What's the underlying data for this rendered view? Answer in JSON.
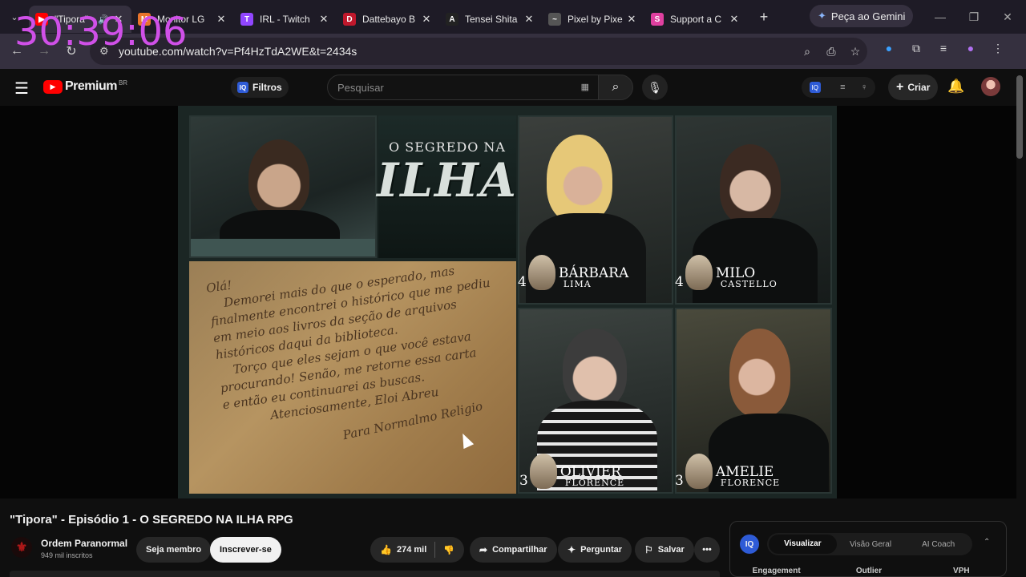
{
  "browser": {
    "tabs": [
      {
        "title": "\"Tipora\"",
        "color": "#ff0000",
        "glyph": "▶",
        "active": true
      },
      {
        "title": "Monitor LG",
        "color": "#e8742c",
        "glyph": "M",
        "active": false
      },
      {
        "title": "IRL - Twitch",
        "color": "#9146ff",
        "glyph": "T",
        "active": false
      },
      {
        "title": "Dattebayo B",
        "color": "#c0182c",
        "glyph": "D",
        "active": false
      },
      {
        "title": "Tensei Shita",
        "color": "#222222",
        "glyph": "A",
        "active": false
      },
      {
        "title": "Pixel by Pixe",
        "color": "#555555",
        "glyph": "~",
        "active": false
      },
      {
        "title": "Support a C",
        "color": "#e040a0",
        "glyph": "S",
        "active": false
      }
    ],
    "gemini_label": "Peça ao Gemini",
    "url": "youtube.com/watch?v=Pf4HzTdA2WE&t=2434s"
  },
  "overlay_timer": "30:39:06",
  "youtube": {
    "brand": "Premium",
    "region": "BR",
    "filtros_label": "Filtros",
    "search_placeholder": "Pesquisar",
    "create_label": "Criar"
  },
  "video": {
    "show_title_top": "O SEGREDO NA",
    "show_title_big": "ILHA",
    "letter_lines": "Olá!\n    Demorei mais do que o esperado, mas\nfinalmente encontrei o histórico que me pediu\nem meio aos livros da seção de arquivos\nhistóricos daqui da biblioteca.\n    Torço que eles sejam o que você estava\nprocurando! Senão, me retorne essa carta\ne então eu continuarei as buscas.\n            Atenciosamente, Eloi Abreu",
    "stamp_text": "Para Normalmo  Religio",
    "players": [
      {
        "first": "BÁRBARA",
        "last": "LIMA",
        "num": "4"
      },
      {
        "first": "MILO",
        "last": "CASTELLO",
        "num": "4"
      },
      {
        "first": "OLIVIER",
        "last": "FLORENCE",
        "num": "3"
      },
      {
        "first": "AMELIE",
        "last": "FLORENCE",
        "num": "3"
      }
    ]
  },
  "meta": {
    "title": "\"Tipora\" - Episódio 1 - O SEGREDO NA ILHA RPG",
    "channel": "Ordem Paranormal",
    "subscribers": "949 mil inscritos",
    "join_label": "Seja membro",
    "subscribe_label": "Inscrever-se",
    "likes": "274 mil",
    "share_label": "Compartilhar",
    "ask_label": "Perguntar",
    "save_label": "Salvar"
  },
  "extension": {
    "badge": "IQ",
    "tabs": [
      "Visualizar",
      "Visão Geral",
      "AI Coach"
    ],
    "metrics": [
      "Engagement",
      "Outlier",
      "VPH"
    ]
  }
}
